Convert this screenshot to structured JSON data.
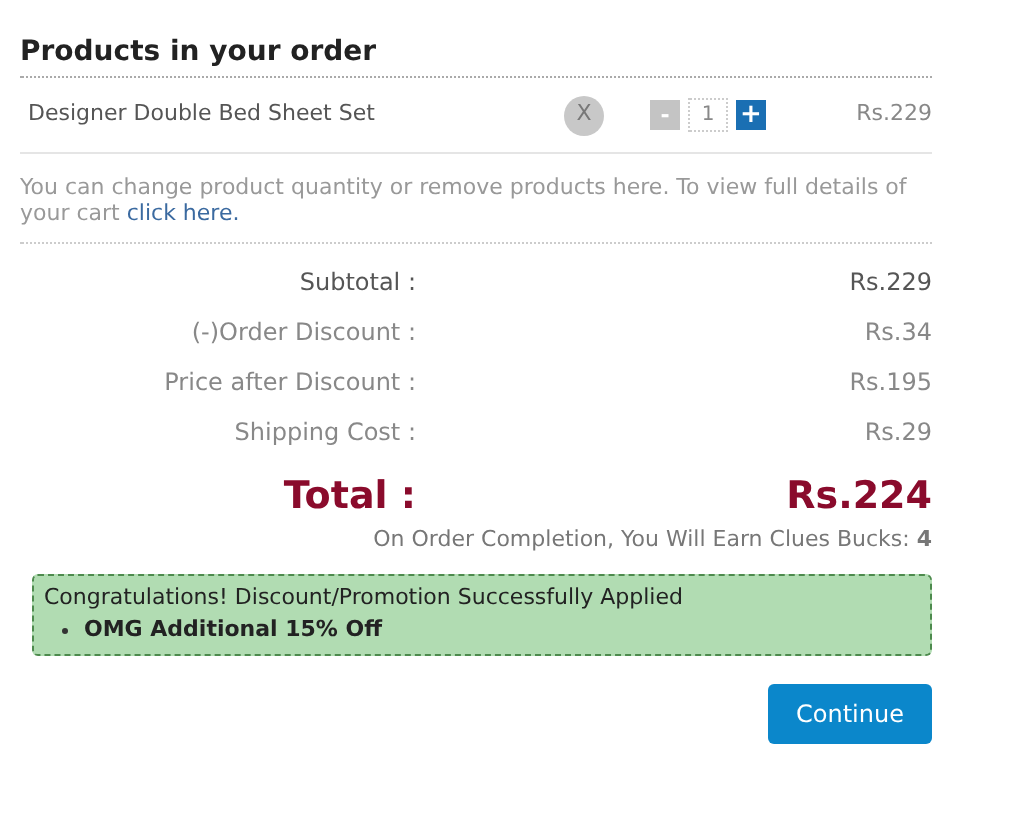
{
  "heading": "Products in your order",
  "products": [
    {
      "name": "Designer Double Bed Sheet Set",
      "remove": "X",
      "decrease": "-",
      "quantity": "1",
      "increase": "+",
      "price": "Rs.229"
    }
  ],
  "note": {
    "text": "You can change product quantity or remove products here. To view full details of your cart",
    "link": "click here."
  },
  "summary": [
    {
      "kind": "subtotal",
      "label": "Subtotal :",
      "value": "Rs.229"
    },
    {
      "kind": "normal",
      "label": "(-)Order Discount :",
      "value": "Rs.34"
    },
    {
      "kind": "normal",
      "label": "Price after Discount :",
      "value": "Rs.195"
    },
    {
      "kind": "normal",
      "label": "Shipping Cost :",
      "value": "Rs.29"
    }
  ],
  "total": {
    "label": "Total :",
    "value": "Rs.224"
  },
  "bucks": "On Order Completion, You Will Earn Clues Bucks: **4**",
  "promo": {
    "message": "Congratulations! Discount/Promotion Successfully Applied",
    "items": [
      "OMG Additional 15% Off"
    ]
  },
  "continue_button": "Continue"
}
